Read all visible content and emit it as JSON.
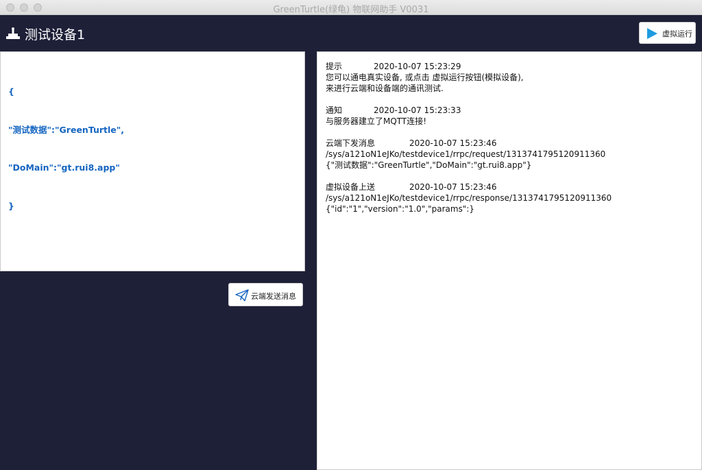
{
  "window": {
    "title": "GreenTurtle(绿龟) 物联网助手 V0031"
  },
  "header": {
    "device_title": "测试设备1",
    "run_button_label": "虚拟运行"
  },
  "editor": {
    "lines": [
      "{",
      "\"测试数据\":\"GreenTurtle\",",
      "\"DoMain\":\"gt.rui8.app\"",
      "}"
    ]
  },
  "send_button_label": "云端发送消息",
  "log": {
    "entries": [
      {
        "type": "提示",
        "time": "2020-10-07 15:23:29",
        "lines": [
          "您可以通电真实设备, 或点击 虚拟运行按钮(模拟设备),",
          "来进行云端和设备端的通讯测试."
        ]
      },
      {
        "type": "通知",
        "time": "2020-10-07 15:23:33",
        "lines": [
          "与服务器建立了MQTT连接!"
        ]
      },
      {
        "type": "云端下发消息",
        "time": "2020-10-07 15:23:46",
        "lines": [
          "/sys/a121oN1eJKo/testdevice1/rrpc/request/1313741795120911360",
          "{\"测试数据\":\"GreenTurtle\",\"DoMain\":\"gt.rui8.app\"}"
        ]
      },
      {
        "type": "虚拟设备上送",
        "time": "2020-10-07 15:23:46",
        "lines": [
          "/sys/a121oN1eJKo/testdevice1/rrpc/response/1313741795120911360",
          "{\"id\":\"1\",\"version\":\"1.0\",\"params\":}"
        ]
      }
    ]
  },
  "colors": {
    "background": "#1e2038",
    "code": "#1565c0",
    "play_icon": "#1e9be0"
  },
  "icons": {
    "device": "device-stand-icon",
    "run": "play-icon",
    "send": "paper-plane-icon"
  }
}
